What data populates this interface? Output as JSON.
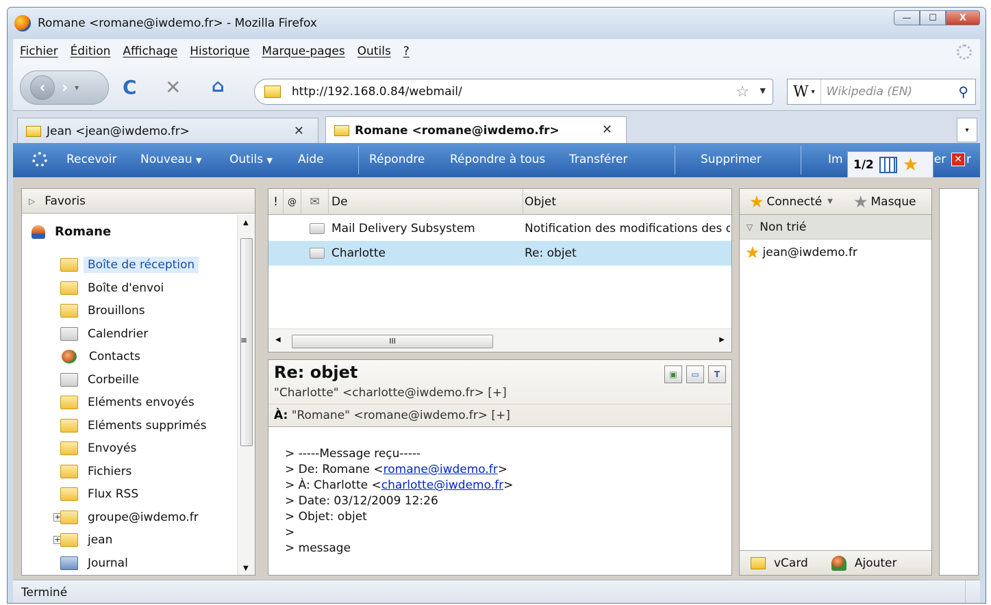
{
  "window": {
    "title": "Romane <romane@iwdemo.fr> - Mozilla Firefox",
    "buttons": {
      "minimize": "—",
      "maximize": "☐",
      "close": "X"
    }
  },
  "menubar": {
    "items": [
      "Fichier",
      "Édition",
      "Affichage",
      "Historique",
      "Marque-pages",
      "Outils",
      "?"
    ]
  },
  "navbar": {
    "url": "http://192.168.0.84/webmail/",
    "search_placeholder": "Wikipedia (EN)",
    "search_engine_icon": "W"
  },
  "tabs": [
    {
      "label": "Jean <jean@iwdemo.fr>",
      "active": false
    },
    {
      "label": "Romane <romane@iwdemo.fr>",
      "active": true
    }
  ],
  "toolbar": {
    "recevoir": "Recevoir",
    "nouveau": "Nouveau",
    "outils": "Outils",
    "aide": "Aide",
    "repondre": "Répondre",
    "repondre_tous": "Répondre à tous",
    "transferer": "Transférer",
    "supprimer": "Supprimer",
    "imprimer_partial": "Im",
    "fermer_partial": "ner",
    "fermer_tail": "r",
    "page_indicator": "1/2"
  },
  "folders": {
    "header": "Favoris",
    "user": "Romane",
    "items": [
      {
        "label": "Boîte de réception",
        "icon": "inbox-folder-icon",
        "selected": true
      },
      {
        "label": "Boîte d'envoi",
        "icon": "outbox-folder-icon"
      },
      {
        "label": "Brouillons",
        "icon": "drafts-icon"
      },
      {
        "label": "Calendrier",
        "icon": "calendar-icon"
      },
      {
        "label": "Contacts",
        "icon": "contacts-icon"
      },
      {
        "label": "Corbeille",
        "icon": "trash-icon"
      },
      {
        "label": "Eléments envoyés",
        "icon": "folder-icon"
      },
      {
        "label": "Eléments supprimés",
        "icon": "folder-icon"
      },
      {
        "label": "Envoyés",
        "icon": "sent-icon"
      },
      {
        "label": "Fichiers",
        "icon": "files-icon"
      },
      {
        "label": "Flux RSS",
        "icon": "folder-icon"
      },
      {
        "label": "groupe@iwdemo.fr",
        "icon": "shared-folder-icon",
        "expandable": true
      },
      {
        "label": "jean",
        "icon": "folder-icon",
        "expandable": true
      },
      {
        "label": "Journal",
        "icon": "journal-icon"
      }
    ]
  },
  "message_list": {
    "columns": {
      "priority": "!",
      "attachment": "@",
      "read": "✉",
      "from": "De",
      "subject": "Objet"
    },
    "rows": [
      {
        "from": "Mail Delivery Subsystem",
        "subject": "Notification des modifications des dr",
        "selected": false
      },
      {
        "from": "Charlotte",
        "subject": "Re: objet",
        "selected": true
      }
    ],
    "hscroll_grip": "III"
  },
  "preview": {
    "subject": "Re: objet",
    "from": "\"Charlotte\" <charlotte@iwdemo.fr> [+]",
    "to_label": "À:",
    "to": "\"Romane\" <romane@iwdemo.fr> [+]",
    "body": {
      "line1": "> -----Message reçu-----",
      "line2_prefix": "> De: Romane <",
      "line2_link": "romane@iwdemo.fr",
      "line2_suffix": ">",
      "line3_prefix": "> À: Charlotte <",
      "line3_link": "charlotte@iwdemo.fr",
      "line3_suffix": ">",
      "line4": "> Date: 03/12/2009 12:26",
      "line5": "> Objet: objet",
      "line6": ">",
      "line7": "> message"
    }
  },
  "im": {
    "status": "Connecté",
    "mask": "Masque",
    "group": "Non trié",
    "contact": "jean@iwdemo.fr",
    "vcard": "vCard",
    "ajouter": "Ajouter"
  },
  "statusbar": {
    "text": "Terminé"
  }
}
